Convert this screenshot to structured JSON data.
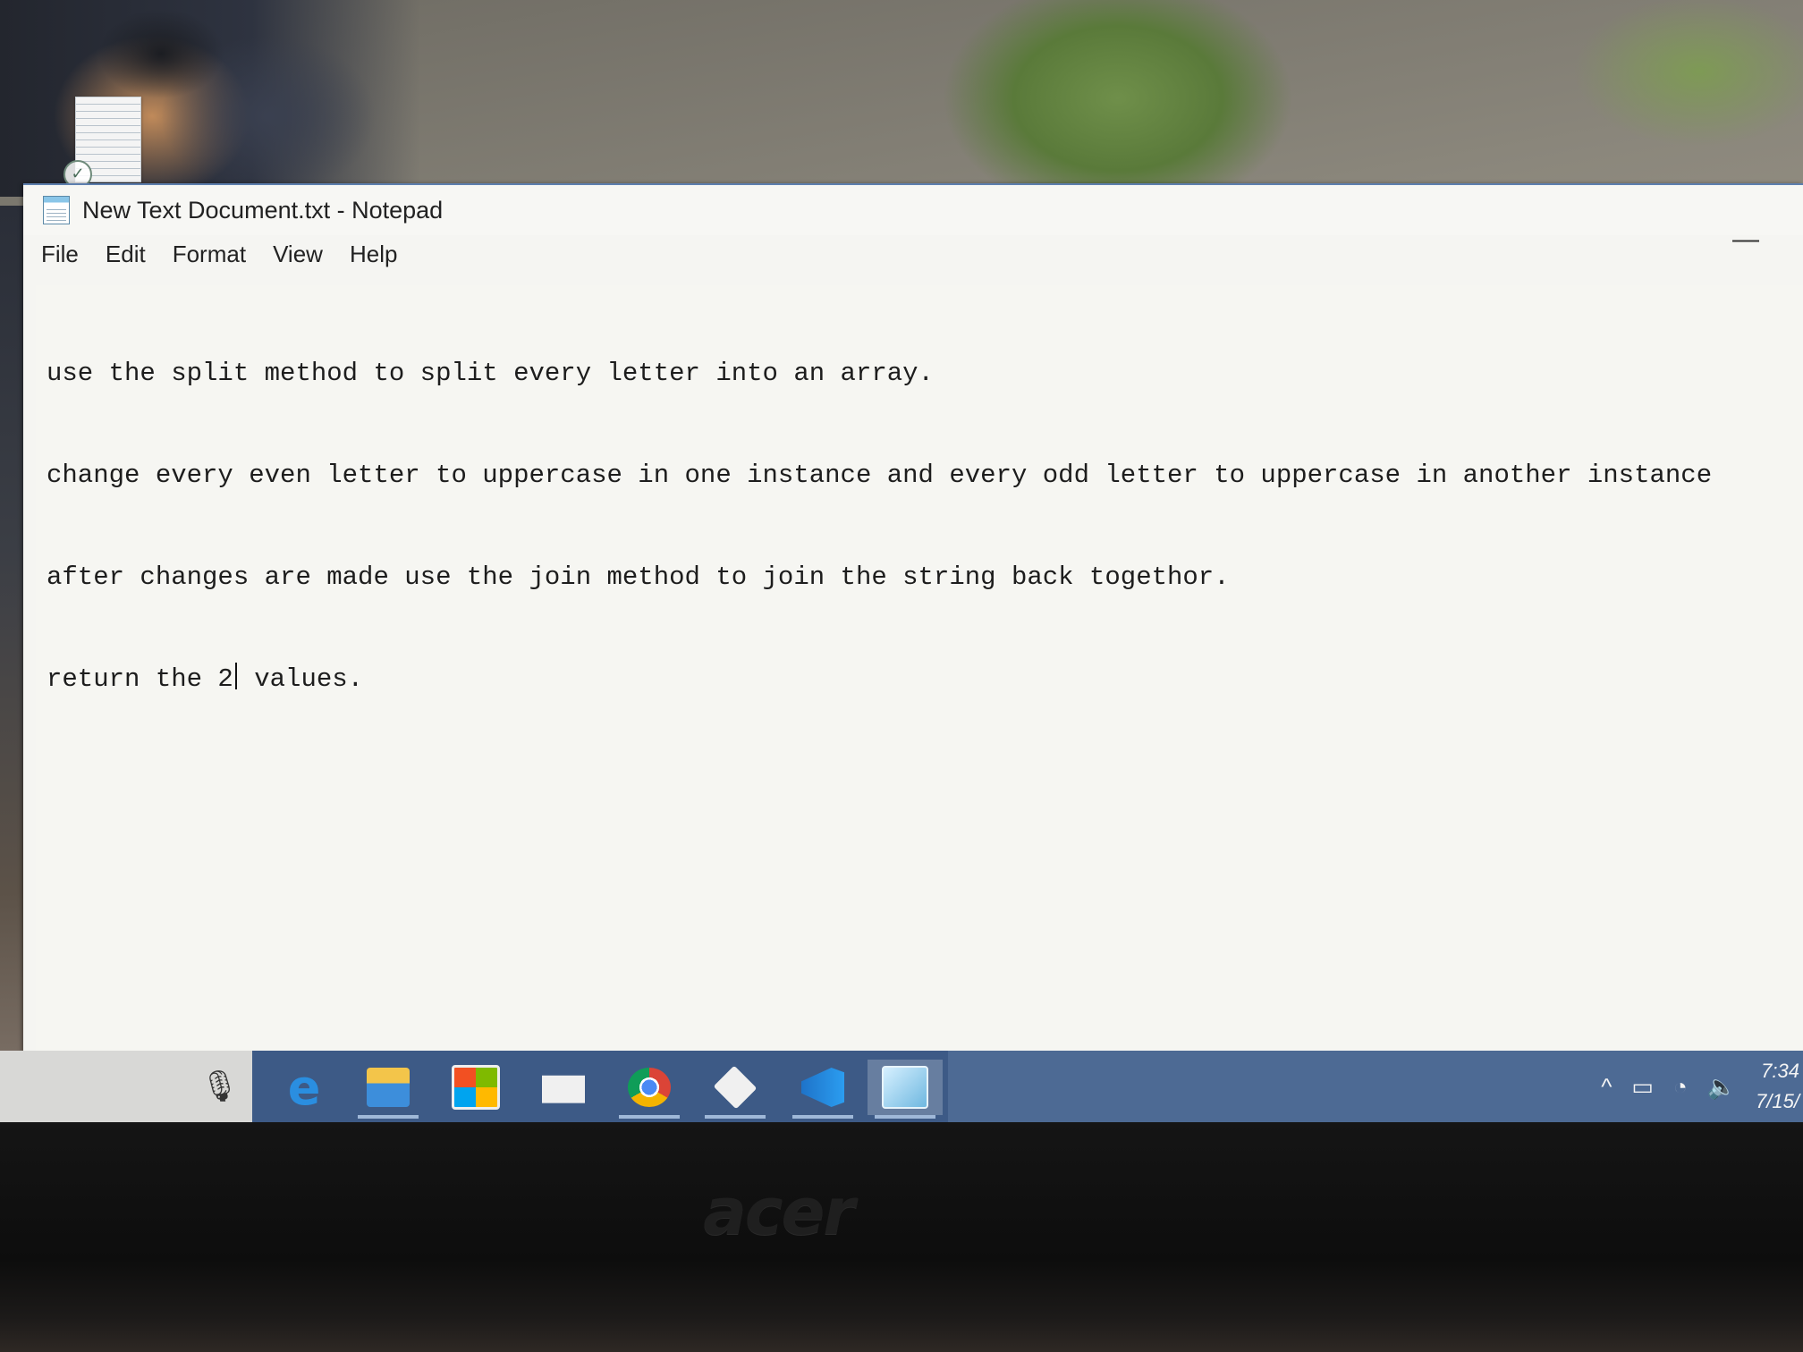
{
  "window": {
    "title": "New Text Document.txt - Notepad",
    "minimize_glyph": "—"
  },
  "menu": [
    "File",
    "Edit",
    "Format",
    "View",
    "Help"
  ],
  "editor": {
    "lines": [
      "use the split method to split every letter into an array.",
      "change every even letter to uppercase in one instance and every odd letter to uppercase in another instance",
      "after changes are made use the join method to join the string back togethor."
    ],
    "last_line_before_caret": "return the 2",
    "last_line_after_caret": " values."
  },
  "taskbar": {
    "apps": [
      {
        "name": "edge-icon",
        "glyph": "e"
      },
      {
        "name": "file-explorer-icon"
      },
      {
        "name": "store-icon"
      },
      {
        "name": "mail-icon"
      },
      {
        "name": "chrome-icon"
      },
      {
        "name": "git-icon"
      },
      {
        "name": "vscode-icon"
      },
      {
        "name": "notepad-icon",
        "active": true
      }
    ],
    "tray": {
      "chevron": "^",
      "clock_time": "7:34",
      "clock_date": "7/15/"
    }
  },
  "monitor": {
    "brand": "acer"
  },
  "colors": {
    "taskbar": "#3d5a86",
    "window_border": "#5d7fae",
    "editor_bg": "#f6f6f2"
  }
}
